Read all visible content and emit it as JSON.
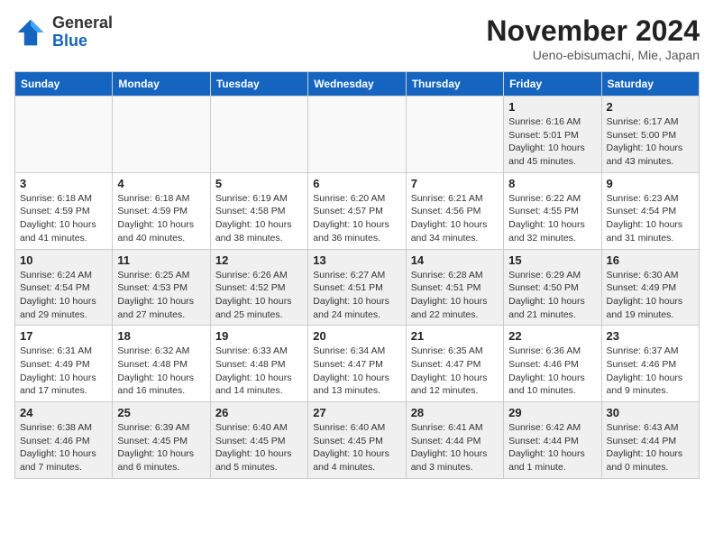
{
  "logo": {
    "general": "General",
    "blue": "Blue"
  },
  "header": {
    "month": "November 2024",
    "location": "Ueno-ebisumachi, Mie, Japan"
  },
  "weekdays": [
    "Sunday",
    "Monday",
    "Tuesday",
    "Wednesday",
    "Thursday",
    "Friday",
    "Saturday"
  ],
  "weeks": [
    [
      {
        "day": "",
        "info": ""
      },
      {
        "day": "",
        "info": ""
      },
      {
        "day": "",
        "info": ""
      },
      {
        "day": "",
        "info": ""
      },
      {
        "day": "",
        "info": ""
      },
      {
        "day": "1",
        "info": "Sunrise: 6:16 AM\nSunset: 5:01 PM\nDaylight: 10 hours\nand 45 minutes."
      },
      {
        "day": "2",
        "info": "Sunrise: 6:17 AM\nSunset: 5:00 PM\nDaylight: 10 hours\nand 43 minutes."
      }
    ],
    [
      {
        "day": "3",
        "info": "Sunrise: 6:18 AM\nSunset: 4:59 PM\nDaylight: 10 hours\nand 41 minutes."
      },
      {
        "day": "4",
        "info": "Sunrise: 6:18 AM\nSunset: 4:59 PM\nDaylight: 10 hours\nand 40 minutes."
      },
      {
        "day": "5",
        "info": "Sunrise: 6:19 AM\nSunset: 4:58 PM\nDaylight: 10 hours\nand 38 minutes."
      },
      {
        "day": "6",
        "info": "Sunrise: 6:20 AM\nSunset: 4:57 PM\nDaylight: 10 hours\nand 36 minutes."
      },
      {
        "day": "7",
        "info": "Sunrise: 6:21 AM\nSunset: 4:56 PM\nDaylight: 10 hours\nand 34 minutes."
      },
      {
        "day": "8",
        "info": "Sunrise: 6:22 AM\nSunset: 4:55 PM\nDaylight: 10 hours\nand 32 minutes."
      },
      {
        "day": "9",
        "info": "Sunrise: 6:23 AM\nSunset: 4:54 PM\nDaylight: 10 hours\nand 31 minutes."
      }
    ],
    [
      {
        "day": "10",
        "info": "Sunrise: 6:24 AM\nSunset: 4:54 PM\nDaylight: 10 hours\nand 29 minutes."
      },
      {
        "day": "11",
        "info": "Sunrise: 6:25 AM\nSunset: 4:53 PM\nDaylight: 10 hours\nand 27 minutes."
      },
      {
        "day": "12",
        "info": "Sunrise: 6:26 AM\nSunset: 4:52 PM\nDaylight: 10 hours\nand 25 minutes."
      },
      {
        "day": "13",
        "info": "Sunrise: 6:27 AM\nSunset: 4:51 PM\nDaylight: 10 hours\nand 24 minutes."
      },
      {
        "day": "14",
        "info": "Sunrise: 6:28 AM\nSunset: 4:51 PM\nDaylight: 10 hours\nand 22 minutes."
      },
      {
        "day": "15",
        "info": "Sunrise: 6:29 AM\nSunset: 4:50 PM\nDaylight: 10 hours\nand 21 minutes."
      },
      {
        "day": "16",
        "info": "Sunrise: 6:30 AM\nSunset: 4:49 PM\nDaylight: 10 hours\nand 19 minutes."
      }
    ],
    [
      {
        "day": "17",
        "info": "Sunrise: 6:31 AM\nSunset: 4:49 PM\nDaylight: 10 hours\nand 17 minutes."
      },
      {
        "day": "18",
        "info": "Sunrise: 6:32 AM\nSunset: 4:48 PM\nDaylight: 10 hours\nand 16 minutes."
      },
      {
        "day": "19",
        "info": "Sunrise: 6:33 AM\nSunset: 4:48 PM\nDaylight: 10 hours\nand 14 minutes."
      },
      {
        "day": "20",
        "info": "Sunrise: 6:34 AM\nSunset: 4:47 PM\nDaylight: 10 hours\nand 13 minutes."
      },
      {
        "day": "21",
        "info": "Sunrise: 6:35 AM\nSunset: 4:47 PM\nDaylight: 10 hours\nand 12 minutes."
      },
      {
        "day": "22",
        "info": "Sunrise: 6:36 AM\nSunset: 4:46 PM\nDaylight: 10 hours\nand 10 minutes."
      },
      {
        "day": "23",
        "info": "Sunrise: 6:37 AM\nSunset: 4:46 PM\nDaylight: 10 hours\nand 9 minutes."
      }
    ],
    [
      {
        "day": "24",
        "info": "Sunrise: 6:38 AM\nSunset: 4:46 PM\nDaylight: 10 hours\nand 7 minutes."
      },
      {
        "day": "25",
        "info": "Sunrise: 6:39 AM\nSunset: 4:45 PM\nDaylight: 10 hours\nand 6 minutes."
      },
      {
        "day": "26",
        "info": "Sunrise: 6:40 AM\nSunset: 4:45 PM\nDaylight: 10 hours\nand 5 minutes."
      },
      {
        "day": "27",
        "info": "Sunrise: 6:40 AM\nSunset: 4:45 PM\nDaylight: 10 hours\nand 4 minutes."
      },
      {
        "day": "28",
        "info": "Sunrise: 6:41 AM\nSunset: 4:44 PM\nDaylight: 10 hours\nand 3 minutes."
      },
      {
        "day": "29",
        "info": "Sunrise: 6:42 AM\nSunset: 4:44 PM\nDaylight: 10 hours\nand 1 minute."
      },
      {
        "day": "30",
        "info": "Sunrise: 6:43 AM\nSunset: 4:44 PM\nDaylight: 10 hours\nand 0 minutes."
      }
    ]
  ]
}
